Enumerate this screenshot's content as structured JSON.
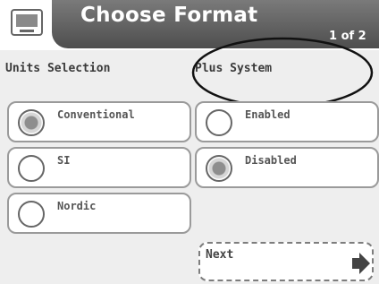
{
  "header": {
    "title": "Choose Format",
    "page_indicator": "1 of 2",
    "icon": "device-icon"
  },
  "units_selection": {
    "label": "Units Selection",
    "options": [
      {
        "label": "Conventional",
        "selected": true
      },
      {
        "label": "SI",
        "selected": false
      },
      {
        "label": "Nordic",
        "selected": false
      }
    ]
  },
  "plus_system": {
    "label": "Plus System",
    "options": [
      {
        "label": "Enabled",
        "selected": false
      },
      {
        "label": "Disabled",
        "selected": true
      }
    ]
  },
  "footer": {
    "next_label": "Next",
    "next_icon": "arrow-right-icon"
  },
  "colors": {
    "title_bar": "#5f5f5f",
    "background": "#eeeeee",
    "selected_radio": "#8e8e8e"
  }
}
